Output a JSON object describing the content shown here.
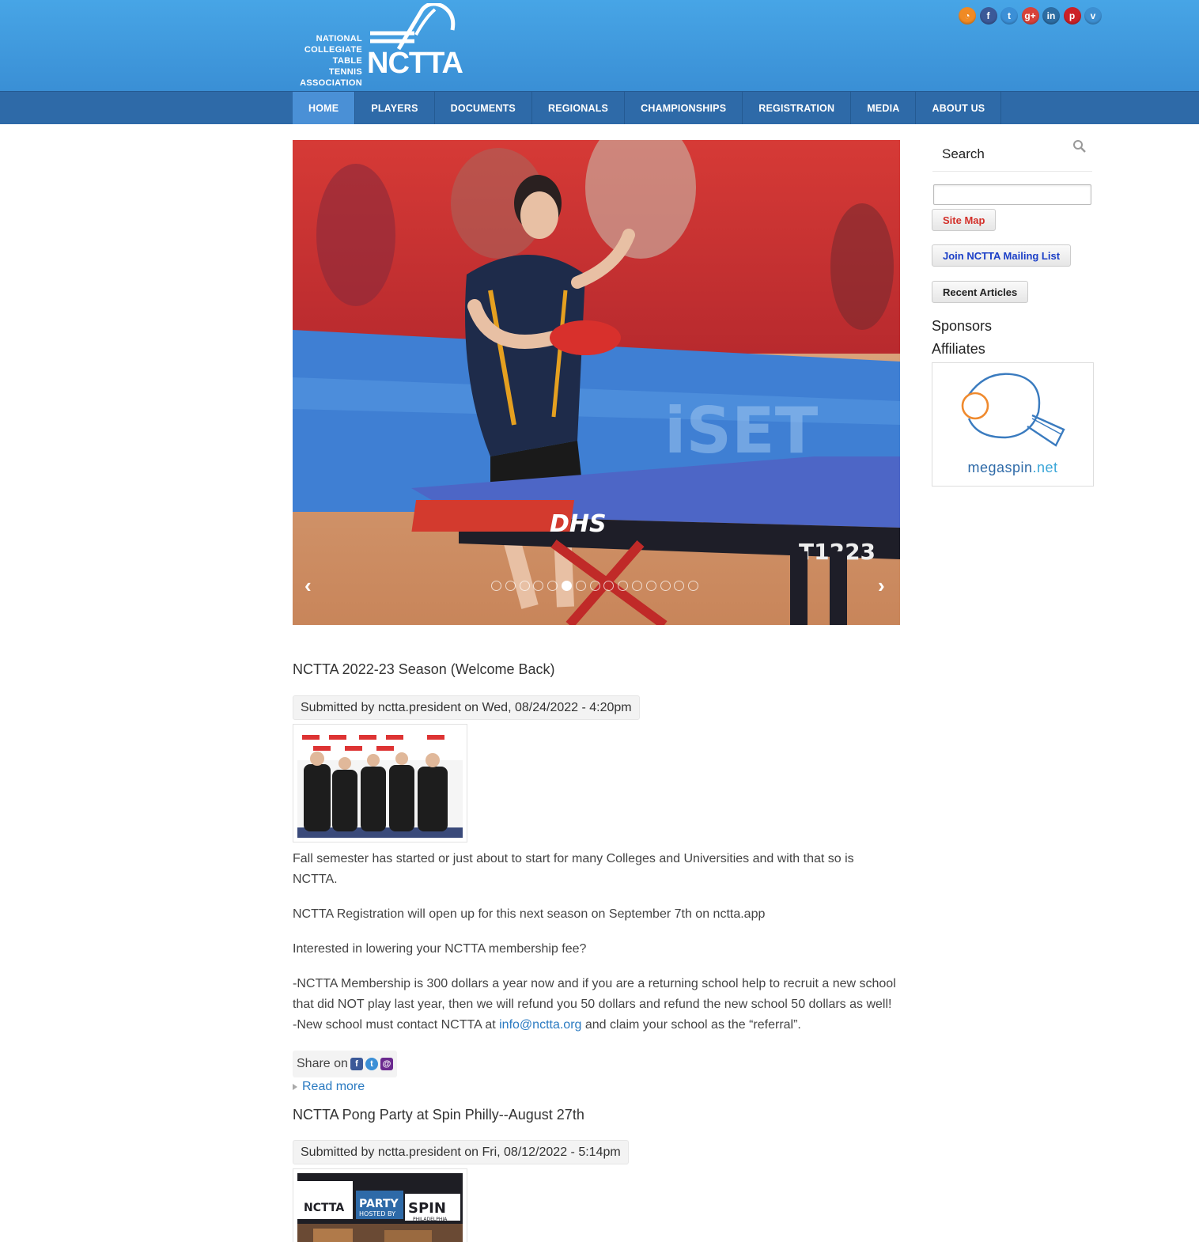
{
  "logo": {
    "lines": [
      "NATIONAL",
      "COLLEGIATE",
      "TABLE TENNIS",
      "ASSOCIATION"
    ],
    "word": "NCTTA"
  },
  "social": [
    {
      "name": "rss-icon",
      "glyph": "◔",
      "color": "#f08a24"
    },
    {
      "name": "facebook-icon",
      "glyph": "f",
      "color": "#3b5998"
    },
    {
      "name": "twitter-icon",
      "glyph": "t",
      "color": "#3b8fd6"
    },
    {
      "name": "googleplus-icon",
      "glyph": "g+",
      "color": "#d8423a"
    },
    {
      "name": "linkedin-icon",
      "glyph": "in",
      "color": "#2d6da3"
    },
    {
      "name": "pinterest-icon",
      "glyph": "p",
      "color": "#cc2127"
    },
    {
      "name": "vimeo-icon",
      "glyph": "v",
      "color": "#3d8fd1"
    }
  ],
  "nav": {
    "items": [
      "HOME",
      "PLAYERS",
      "DOCUMENTS",
      "REGIONALS",
      "CHAMPIONSHIPS",
      "REGISTRATION",
      "MEDIA",
      "ABOUT US"
    ],
    "active": "HOME"
  },
  "slider": {
    "prev": "‹",
    "next": "›",
    "total_slides": 15,
    "current_slide": 6,
    "image_text": {
      "table_brand": "DHS",
      "table_model": "T1223",
      "banner": "iSET"
    }
  },
  "articles": [
    {
      "title": "NCTTA 2022-23 Season (Welcome Back)",
      "meta": "Submitted by nctta.president on Wed, 08/24/2022 - 4:20pm",
      "para1": "Fall semester has started or just about to start for many Colleges and Universities and with that so is NCTTA.",
      "para2": "NCTTA Registration will open up for this next season on September 7th on nctta.app",
      "para3": "Interested in lowering your NCTTA membership fee?",
      "para4a": "-NCTTA Membership is 300 dollars a year now and if you are a returning school help to recruit a new school that did NOT play last year, then we will refund you 50 dollars and refund the new school 50 dollars as well!",
      "para4b_pre": "-New school must contact NCTTA at ",
      "para4b_link": "info@nctta.org",
      "para4b_post": " and claim your school as the “referral”."
    },
    {
      "title": "NCTTA Pong Party at Spin Philly--August 27th",
      "meta": "Submitted by nctta.president on Fri, 08/12/2022 - 5:14pm",
      "thumb_text": {
        "logo": "NCTTA",
        "party": "PARTY",
        "hosted": "HOSTED BY",
        "spin": "SPIN",
        "city": "PHILADELPHIA"
      }
    }
  ],
  "share": {
    "label": "Share on"
  },
  "readmore": "Read more",
  "sidebar": {
    "search_title": "Search",
    "search_value": "",
    "site_map": "Site Map",
    "mailing_list": "Join NCTTA Mailing List",
    "recent_articles": "Recent Articles",
    "sponsors": "Sponsors",
    "affiliates": "Affiliates",
    "sponsor_name_a": "megaspin",
    "sponsor_name_b": ".net"
  },
  "colors": {
    "header": "#3a8fd5",
    "nav": "#2e6aa8",
    "nav_active": "#4a90d6",
    "link": "#2a7ac1",
    "site_map": "#d3302a",
    "mailing": "#1b3fc7"
  }
}
